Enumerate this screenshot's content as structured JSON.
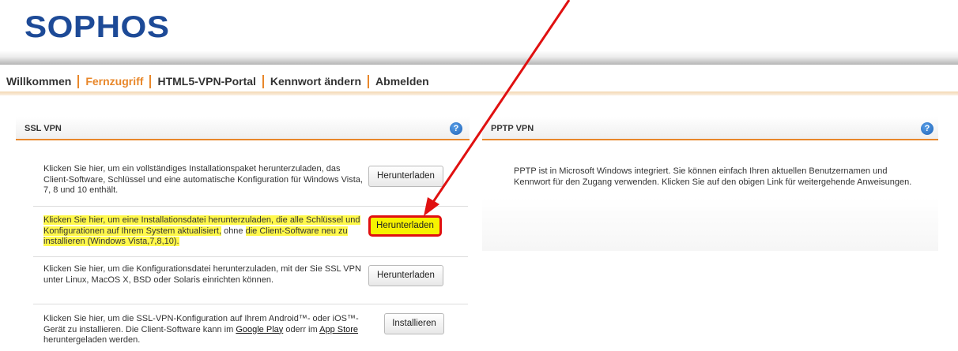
{
  "brand": {
    "logo_text": "SOPHOS",
    "logo_color": "#1d4a97"
  },
  "nav": {
    "items": [
      {
        "label": "Willkommen",
        "active": false
      },
      {
        "label": "Fernzugriff",
        "active": true
      },
      {
        "label": "HTML5-VPN-Portal",
        "active": false
      },
      {
        "label": "Kennwort ändern",
        "active": false
      },
      {
        "label": "Abmelden",
        "active": false
      }
    ],
    "accent_color": "#e8872a"
  },
  "ssl_panel": {
    "title": "SSL VPN",
    "help": "?",
    "rows": [
      {
        "text": "Klicken Sie hier, um ein vollständiges Installationspaket herunterzuladen, das Client-Software, Schlüssel und eine automatische Konfiguration für Windows Vista, 7, 8 und 10 enthält.",
        "button": "Herunterladen"
      },
      {
        "text_highlighted": "Klicken Sie hier, um eine Installationsdatei herunterzuladen, die alle Schlüssel und Konfigurationen auf Ihrem System aktualisiert,",
        "text_plain": " ohne ",
        "text_highlighted_2": "die Client-Software neu zu installieren (Windows Vista,7,8,10).",
        "button": "Herunterladen"
      },
      {
        "text": "Klicken Sie hier, um die Konfigurationsdatei herunterzuladen, mit der Sie SSL VPN unter Linux, MacOS X, BSD oder Solaris einrichten können.",
        "button": "Herunterladen"
      },
      {
        "text_before": "Klicken Sie hier, um die SSL-VPN-Konfiguration auf Ihrem Android™- oder iOS™-Gerät zu installieren. Die Client-Software kann im ",
        "link_1": "Google Play",
        "text_middle": " oderr im ",
        "link_2": "App Store",
        "text_after": " heruntergeladen werden.",
        "button": "Installieren"
      }
    ]
  },
  "pptp_panel": {
    "title": "PPTP VPN",
    "help": "?",
    "text": "PPTP ist in Microsoft Windows integriert. Sie können einfach Ihren aktuellen Benutzernamen und Kennwort für den Zugang verwenden. Klicken Sie auf den obigen Link für weitergehende Anweisungen."
  },
  "annotation": {
    "arrow_color": "#e01010",
    "highlight_color": "#fff84a"
  }
}
